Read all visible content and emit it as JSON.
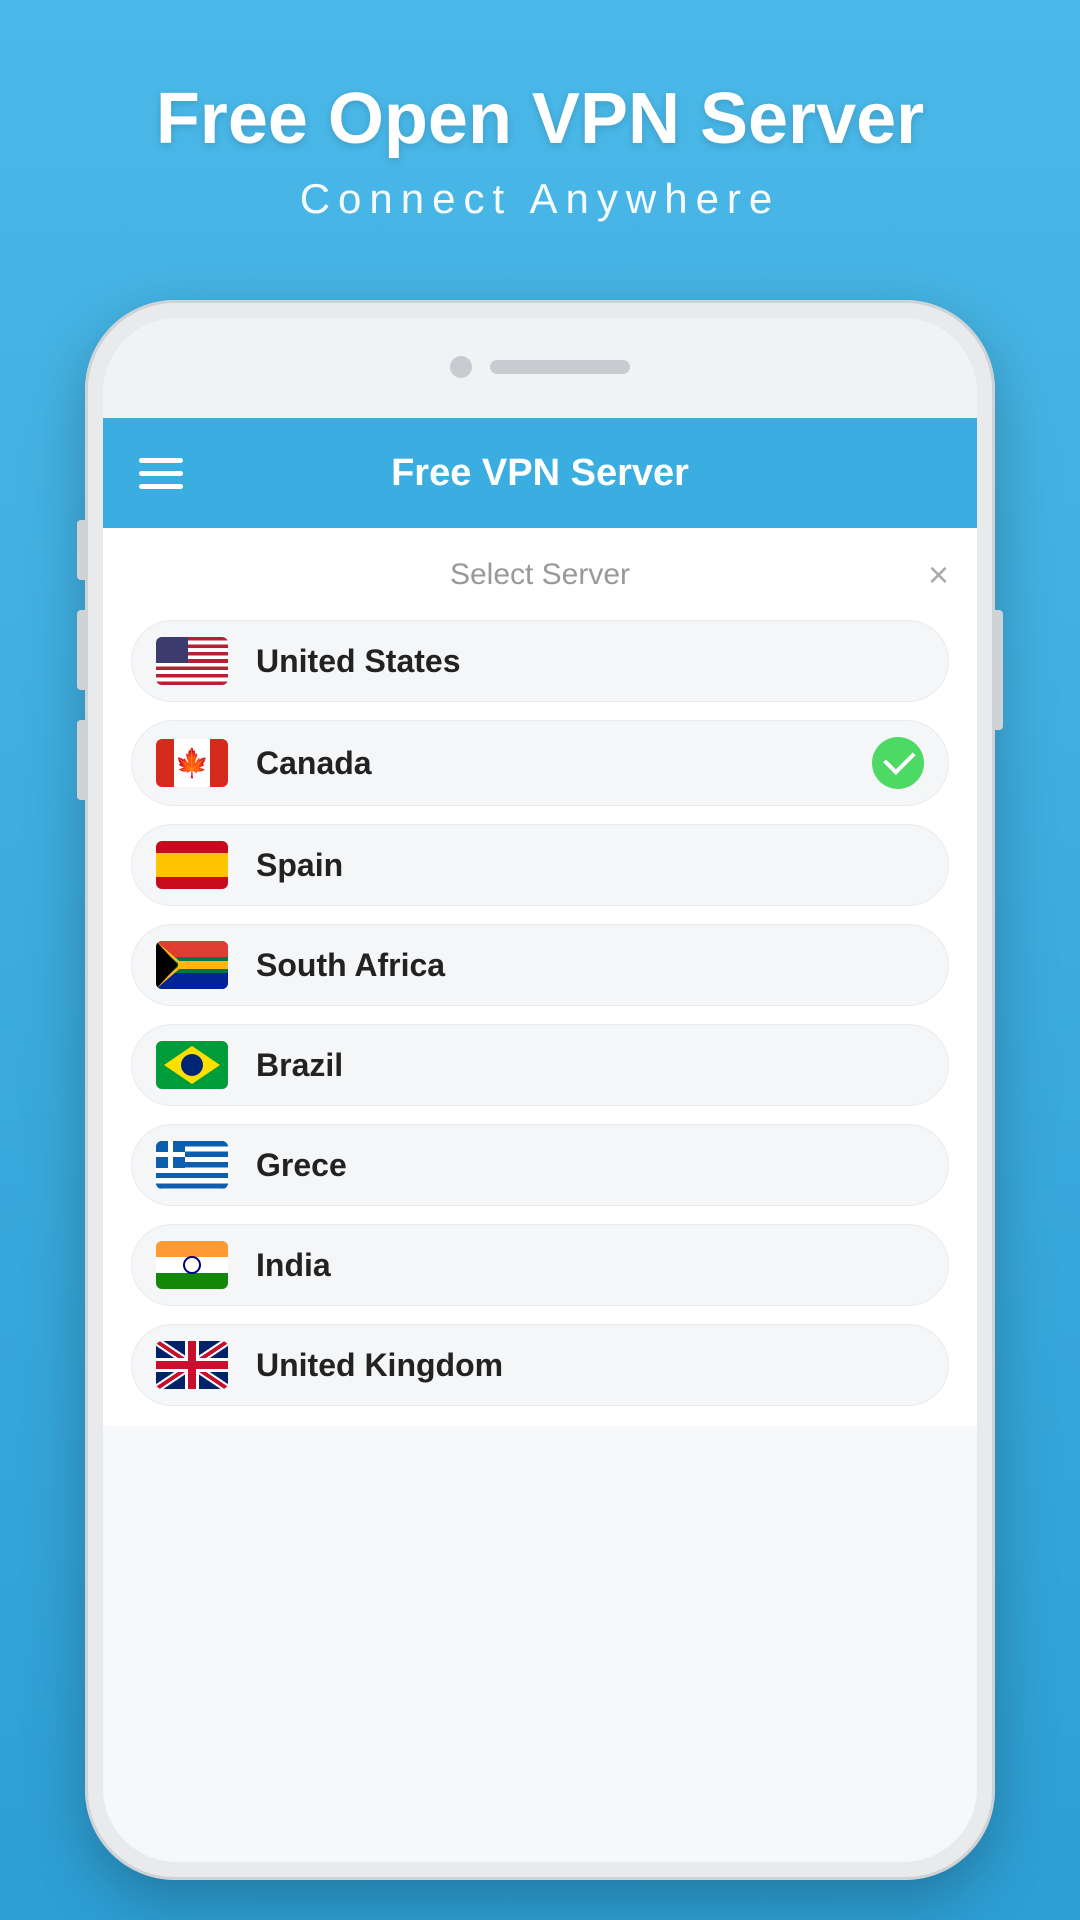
{
  "app": {
    "background_color": "#3aaee0",
    "header": {
      "title": "Free Open VPN Server",
      "subtitle": "Connect Anywhere"
    },
    "app_bar": {
      "title": "Free VPN Server",
      "menu_icon": "hamburger-icon"
    },
    "dialog": {
      "title": "Select Server",
      "close_label": "×"
    },
    "servers": [
      {
        "name": "United States",
        "flag": "us",
        "selected": false
      },
      {
        "name": "Canada",
        "flag": "ca",
        "selected": true
      },
      {
        "name": "Spain",
        "flag": "es",
        "selected": false
      },
      {
        "name": "South Africa",
        "flag": "za",
        "selected": false
      },
      {
        "name": "Brazil",
        "flag": "br",
        "selected": false
      },
      {
        "name": "Grece",
        "flag": "gr",
        "selected": false
      },
      {
        "name": "India",
        "flag": "in",
        "selected": false
      },
      {
        "name": "United Kingdom",
        "flag": "gb",
        "selected": false
      }
    ]
  }
}
